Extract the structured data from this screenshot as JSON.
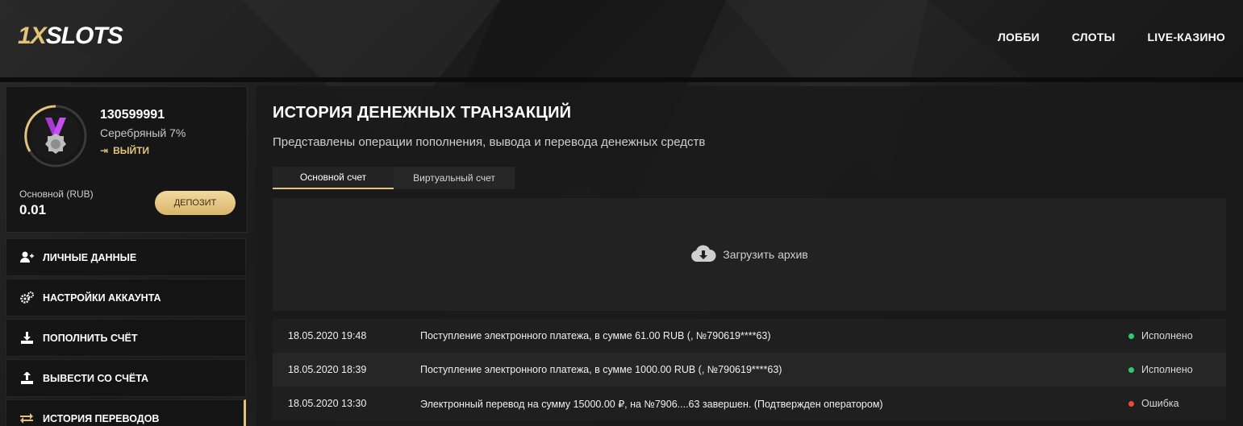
{
  "header": {
    "logo_prefix": "1X",
    "logo_text": "SLOTS",
    "nav": [
      "ЛОББИ",
      "СЛОТЫ",
      "LIVE-КАЗИНО"
    ]
  },
  "profile": {
    "user_id": "130599991",
    "level": "Серебряный 7%",
    "logout": "ВЫЙТИ",
    "balance_label": "Основной (RUB)",
    "balance_value": "0.01",
    "deposit": "ДЕПОЗИТ"
  },
  "menu": [
    {
      "label": "ЛИЧНЫЕ ДАННЫЕ",
      "icon": "user-plus-icon"
    },
    {
      "label": "НАСТРОЙКИ АККАУНТА",
      "icon": "gears-icon"
    },
    {
      "label": "ПОПОЛНИТЬ СЧЁТ",
      "icon": "download-icon"
    },
    {
      "label": "ВЫВЕСТИ СО СЧЁТА",
      "icon": "upload-icon"
    },
    {
      "label": "ИСТОРИЯ ПЕРЕВОДОВ",
      "icon": "transfer-arrows-icon"
    }
  ],
  "main": {
    "title": "ИСТОРИЯ ДЕНЕЖНЫХ ТРАНЗАКЦИЙ",
    "subtitle": "Представлены операции пополнения, вывода и перевода денежных средств",
    "tabs": [
      "Основной счет",
      "Виртуальный счет"
    ],
    "archive": "Загрузить архив"
  },
  "transactions": [
    {
      "date": "18.05.2020 19:48",
      "desc": "Поступление электронного платежа, в сумме 61.00 RUB (, №790619****63)",
      "status": "Исполнено",
      "status_color": "#2ecc71"
    },
    {
      "date": "18.05.2020 18:39",
      "desc": "Поступление электронного платежа, в сумме 1000.00 RUB (, №790619****63)",
      "status": "Исполнено",
      "status_color": "#2ecc71"
    },
    {
      "date": "18.05.2020 13:30",
      "desc": "Электронный перевод на сумму 15000.00 ₽, на №7906....63 завершен. (Подтвержден оператором)",
      "status": "Ошибка",
      "status_color": "#e74c3c"
    }
  ],
  "colors": {
    "accent": "#e3c27a",
    "success": "#2ecc71",
    "error": "#e74c3c"
  }
}
